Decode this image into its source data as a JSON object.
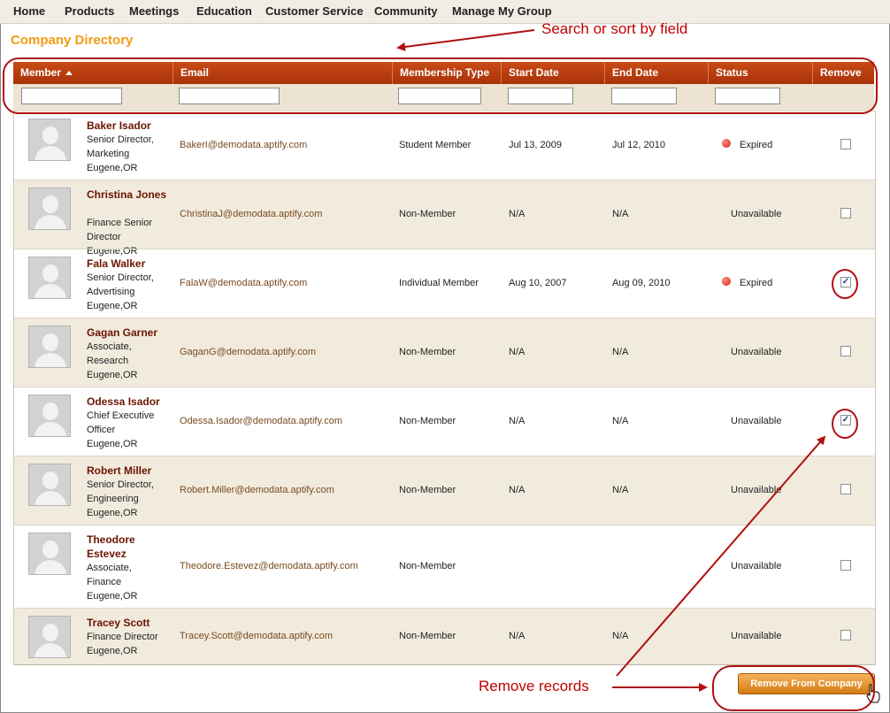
{
  "nav": {
    "items": [
      "Home",
      "Products",
      "Meetings",
      "Education",
      "Customer Service",
      "Community",
      "Manage My Group"
    ]
  },
  "page_title": "Company Directory",
  "callouts": {
    "search": "Search or sort by field",
    "remove": "Remove records"
  },
  "grid": {
    "columns": [
      "Member",
      "Email",
      "Membership Type",
      "Start Date",
      "End Date",
      "Status",
      "Remove"
    ],
    "sort_column": "Member",
    "rows": [
      {
        "name": "Baker Isador",
        "info": [
          "Senior Director,",
          "Marketing",
          "Eugene,OR"
        ],
        "email": "BakerI@demodata.aptify.com",
        "type": "Student Member",
        "start": "Jul 13, 2009",
        "end": "Jul 12, 2010",
        "status": "Expired",
        "status_dot": true,
        "checked": false
      },
      {
        "name": "Christina Jones",
        "info": [
          "Finance Senior",
          "Director",
          "Eugene,OR"
        ],
        "email": "ChristinaJ@demodata.aptify.com",
        "type": "Non-Member",
        "start": "N/A",
        "end": "N/A",
        "status": "Unavailable",
        "status_dot": false,
        "checked": false
      },
      {
        "name": "Fala Walker",
        "info": [
          "Senior Director,",
          "Advertising",
          "Eugene,OR"
        ],
        "email": "FalaW@demodata.aptify.com",
        "type": "Individual Member",
        "start": "Aug 10, 2007",
        "end": "Aug 09, 2010",
        "status": "Expired",
        "status_dot": true,
        "checked": true
      },
      {
        "name": "Gagan Garner",
        "info": [
          "Associate,",
          "Research",
          "Eugene,OR"
        ],
        "email": "GaganG@demodata.aptify.com",
        "type": "Non-Member",
        "start": "N/A",
        "end": "N/A",
        "status": "Unavailable",
        "status_dot": false,
        "checked": false
      },
      {
        "name": "Odessa Isador",
        "info": [
          "Chief Executive",
          "Officer",
          "Eugene,OR"
        ],
        "email": "Odessa.Isador@demodata.aptify.com",
        "type": "Non-Member",
        "start": "N/A",
        "end": "N/A",
        "status": "Unavailable",
        "status_dot": false,
        "checked": true
      },
      {
        "name": "Robert Miller",
        "info": [
          "Senior Director,",
          "Engineering",
          "Eugene,OR"
        ],
        "email": "Robert.Miller@demodata.aptify.com",
        "type": "Non-Member",
        "start": "N/A",
        "end": "N/A",
        "status": "Unavailable",
        "status_dot": false,
        "checked": false
      },
      {
        "name": "Theodore Estevez",
        "info": [
          "Associate,",
          "Finance",
          "Eugene,OR"
        ],
        "email": "Theodore.Estevez@demodata.aptify.com",
        "type": "Non-Member",
        "start": "",
        "end": "",
        "status": "Unavailable",
        "status_dot": false,
        "checked": false
      },
      {
        "name": "Tracey Scott",
        "info": [
          "Finance Director",
          "Eugene,OR"
        ],
        "email": "Tracey.Scott@demodata.aptify.com",
        "type": "Non-Member",
        "start": "N/A",
        "end": "N/A",
        "status": "Unavailable",
        "status_dot": false,
        "checked": false
      }
    ]
  },
  "remove_button": "Remove From Company",
  "colors": {
    "header": "#c94b16",
    "title": "#f39b16",
    "annotation": "#c00000",
    "name": "#6b1400"
  }
}
